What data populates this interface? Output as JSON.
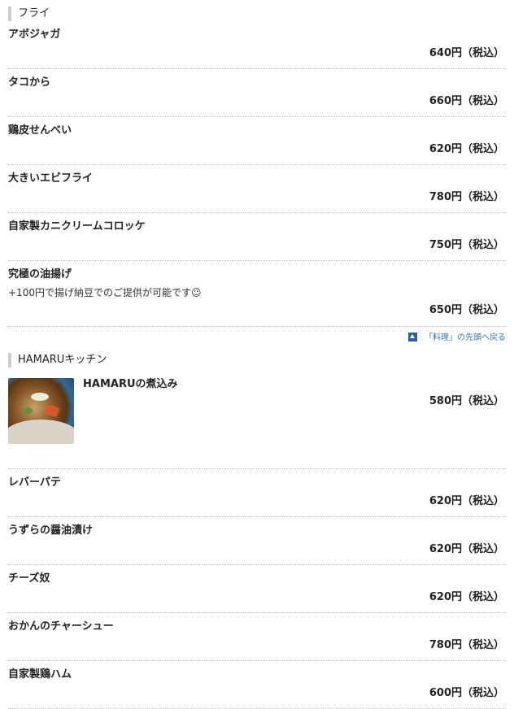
{
  "sections": [
    {
      "title": "フライ",
      "items": [
        {
          "name": "アボジャガ",
          "price": "640円（税込）"
        },
        {
          "name": "タコから",
          "price": "660円（税込）"
        },
        {
          "name": "鶏皮せんべい",
          "price": "620円（税込）"
        },
        {
          "name": "大きいエビフライ",
          "price": "780円（税込）"
        },
        {
          "name": "自家製カニクリームコロッケ",
          "price": "750円（税込）"
        },
        {
          "name": "究極の油揚げ",
          "description": "+100円で揚げ納豆でのご提供が可能です☺",
          "price": "650円（税込）"
        }
      ]
    },
    {
      "title": "HAMARUキッチン",
      "items": [
        {
          "name": "HAMARUの煮込み",
          "price": "580円（税込）"
        },
        {
          "name": "レバーパテ",
          "price": "620円（税込）"
        },
        {
          "name": "うずらの醤油漬け",
          "price": "620円（税込）"
        },
        {
          "name": "チーズ奴",
          "price": "620円（税込）"
        },
        {
          "name": "おかんのチャーシュー",
          "price": "780円（税込）"
        },
        {
          "name": "自家製鶏ハム",
          "price": "600円（税込）"
        }
      ]
    }
  ],
  "back_link": {
    "label": "「料理」の先頭へ戻る",
    "icon": "arrow-up-icon"
  }
}
